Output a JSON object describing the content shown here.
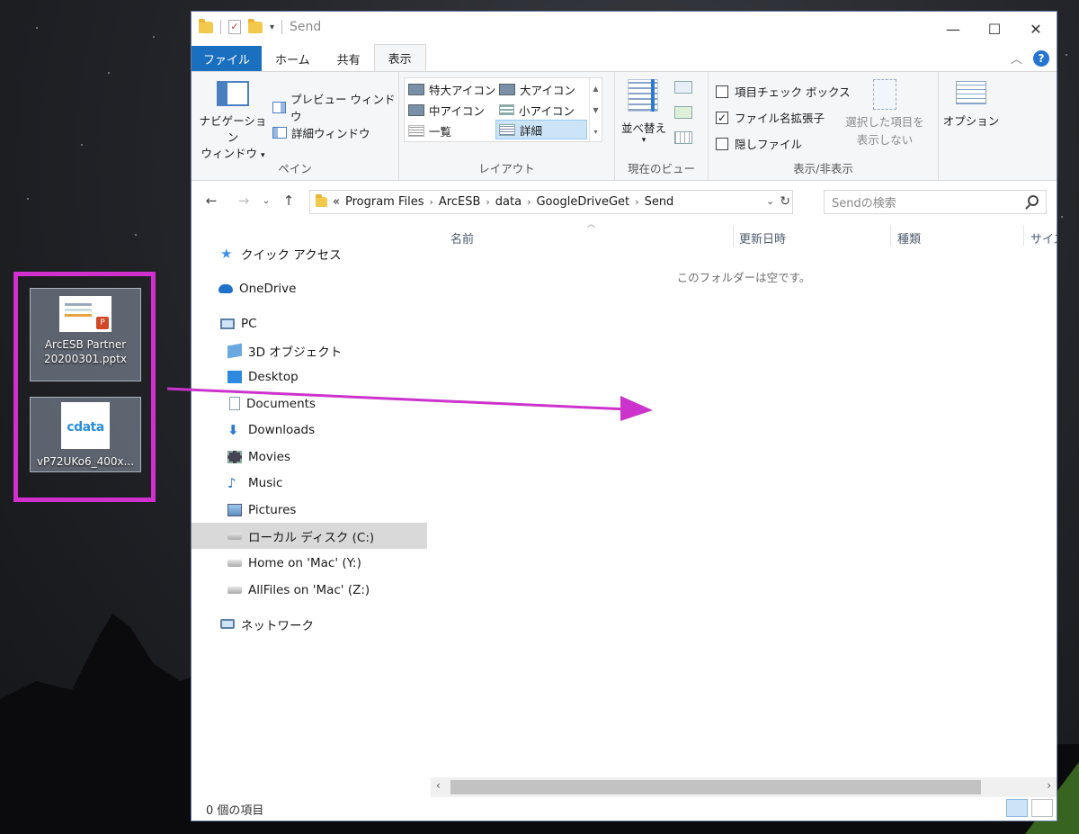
{
  "desktop": {
    "icons": [
      {
        "label_line1": "ArcESB Partner",
        "label_line2": "20200301.pptx"
      },
      {
        "label_line1": "vP72UKo6_400x...",
        "label_line2": "",
        "logo_text": "cdata"
      }
    ],
    "selection_color": "#d22fcf"
  },
  "window": {
    "title": "Send",
    "caption": {
      "minimize": "—",
      "maximize": "☐",
      "close": "✕"
    }
  },
  "tabs": [
    {
      "label": "ファイル"
    },
    {
      "label": "ホーム"
    },
    {
      "label": "共有"
    },
    {
      "label": "表示"
    }
  ],
  "ribbon": {
    "pane": {
      "nav_pane_line1": "ナビゲーション",
      "nav_pane_line2": "ウィンドウ",
      "preview": "プレビュー ウィンドウ",
      "details": "詳細ウィンドウ",
      "label": "ペイン"
    },
    "layout": {
      "items": [
        "特大アイコン",
        "大アイコン",
        "中アイコン",
        "小アイコン",
        "一覧",
        "詳細"
      ],
      "selected": "詳細",
      "label": "レイアウト"
    },
    "view": {
      "sort": "並べ替え",
      "label": "現在のビュー"
    },
    "showhide": {
      "item_checkbox": "項目チェック ボックス",
      "file_ext": "ファイル名拡張子",
      "hidden_files": "隠しファイル",
      "hide_selected_line1": "選択した項目を",
      "hide_selected_line2": "表示しない",
      "label": "表示/非表示"
    },
    "options": {
      "label": "オプション"
    }
  },
  "address": {
    "crumbs": [
      "Program Files",
      "ArcESB",
      "data",
      "GoogleDriveGet",
      "Send"
    ],
    "prefix": "«"
  },
  "search": {
    "placeholder": "Sendの検索"
  },
  "nav": {
    "items": [
      {
        "label": "クイック アクセス"
      },
      {
        "label": "OneDrive"
      },
      {
        "label": "PC"
      },
      {
        "label": "3D オブジェクト"
      },
      {
        "label": "Desktop"
      },
      {
        "label": "Documents"
      },
      {
        "label": "Downloads"
      },
      {
        "label": "Movies"
      },
      {
        "label": "Music"
      },
      {
        "label": "Pictures"
      },
      {
        "label": "ローカル ディスク (C:)"
      },
      {
        "label": "Home on 'Mac' (Y:)"
      },
      {
        "label": "AllFiles on 'Mac' (Z:)"
      },
      {
        "label": "ネットワーク"
      }
    ]
  },
  "columns": [
    "名前",
    "更新日時",
    "種類",
    "サイズ"
  ],
  "empty_message": "このフォルダーは空です。",
  "status": {
    "text": "0 個の項目"
  }
}
